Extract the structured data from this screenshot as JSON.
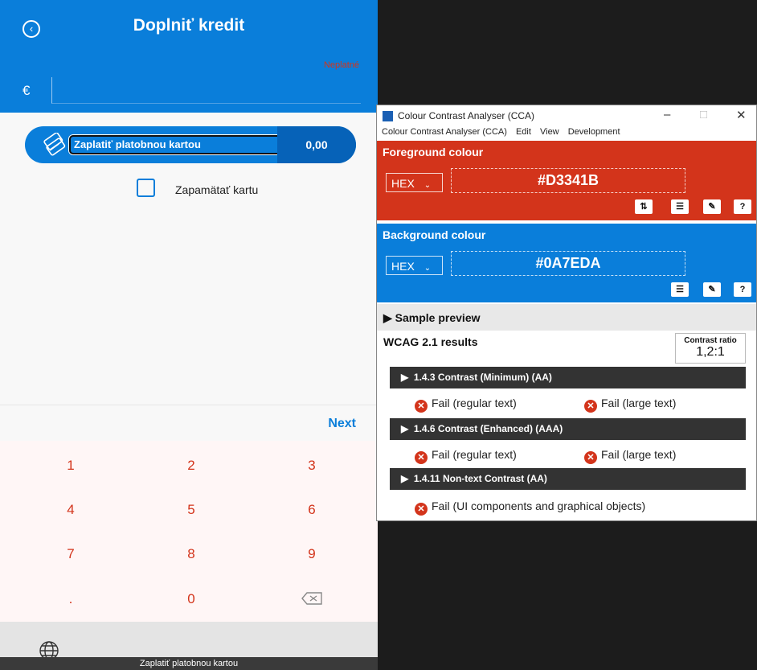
{
  "phone": {
    "title": "Doplniť kredit",
    "invalid_label": "Neplatné",
    "currency_symbol": "€",
    "pay_label": "Zaplatiť platobnou kartou",
    "pay_amount": "0,00",
    "remember_label": "Zapamätať kartu",
    "next_label": "Next",
    "keys": [
      "1",
      "2",
      "3",
      "4",
      "5",
      "6",
      "7",
      "8",
      "9",
      ".",
      "0"
    ],
    "bottom_strip": "Zaplatiť platobnou kartou",
    "colors": {
      "brand": "#0a7eda",
      "key_text": "#d3341b"
    }
  },
  "cca": {
    "title": "Colour Contrast Analyser (CCA)",
    "menu": [
      "Colour Contrast Analyser (CCA)",
      "Edit",
      "View",
      "Development"
    ],
    "foreground": {
      "title": "Foreground colour",
      "format": "HEX",
      "value": "#D3341B",
      "color": "#d3341b"
    },
    "background": {
      "title": "Background colour",
      "format": "HEX",
      "value": "#0A7EDA",
      "color": "#0a7eda"
    },
    "sample_preview": "Sample preview",
    "wcag_heading": "WCAG 2.1 results",
    "contrast_label": "Contrast ratio",
    "contrast_value": "1,2:1",
    "criteria": [
      {
        "label": "1.4.3 Contrast (Minimum) (AA)",
        "results": [
          "Fail (regular text)",
          "Fail (large text)"
        ]
      },
      {
        "label": "1.4.6 Contrast (Enhanced) (AAA)",
        "results": [
          "Fail (regular text)",
          "Fail (large text)"
        ]
      },
      {
        "label": "1.4.11 Non-text Contrast (AA)",
        "results": [
          "Fail (UI components and graphical objects)"
        ]
      }
    ]
  }
}
